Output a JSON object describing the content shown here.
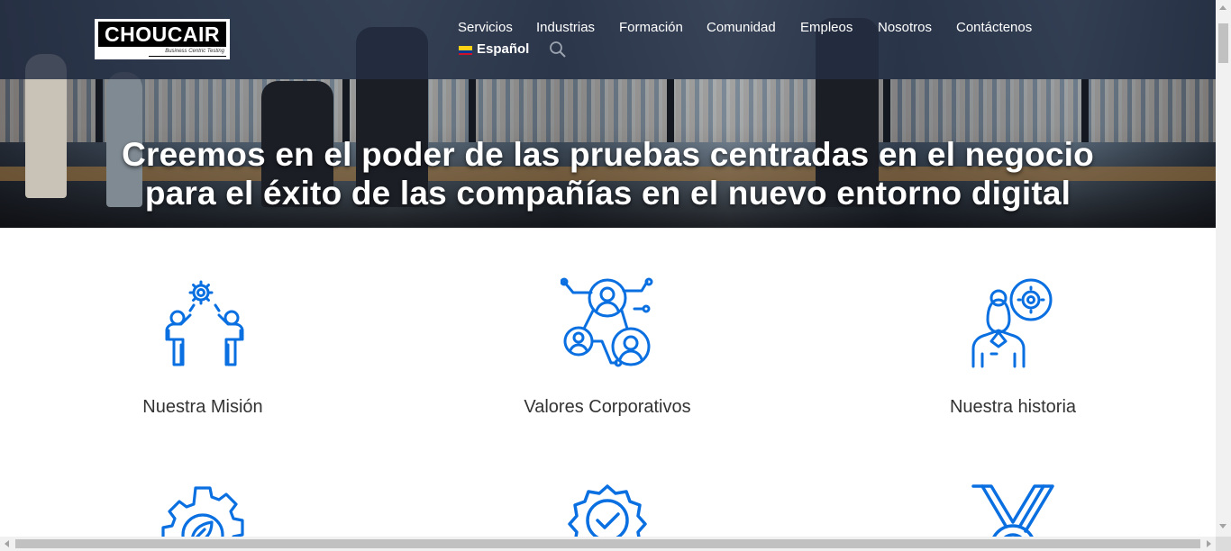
{
  "header": {
    "logo": {
      "brand": "CHOUCAIR",
      "tagline": "Business Centric Testing"
    },
    "nav": [
      {
        "label": "Servicios"
      },
      {
        "label": "Industrias"
      },
      {
        "label": "Formación"
      },
      {
        "label": "Comunidad"
      },
      {
        "label": "Empleos"
      },
      {
        "label": "Nosotros"
      },
      {
        "label": "Contáctenos"
      }
    ],
    "language": {
      "label": "Español",
      "flag_icon": "colombia-flag-icon"
    },
    "search_icon": "search-icon"
  },
  "hero": {
    "title_line1": "Creemos en el poder de las pruebas centradas en el negocio",
    "title_line2": "para el éxito de las compañías en el nuevo entorno digital"
  },
  "features": [
    {
      "label": "Nuestra Misión",
      "icon": "team-gear-icon"
    },
    {
      "label": "Valores Corporativos",
      "icon": "people-network-icon"
    },
    {
      "label": "Nuestra historia",
      "icon": "person-gear-icon"
    },
    {
      "label": "",
      "icon": "gear-leaf-icon"
    },
    {
      "label": "",
      "icon": "badge-check-icon"
    },
    {
      "label": "",
      "icon": "medal-icon"
    }
  ],
  "colors": {
    "accent": "#0a6fe0",
    "header_bg": "#263044",
    "text": "#333333"
  }
}
